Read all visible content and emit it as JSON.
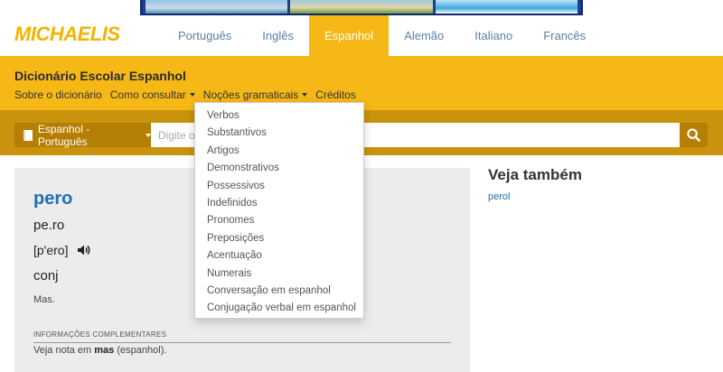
{
  "header": {
    "logo": "MICHAELIS",
    "languages": [
      "Português",
      "Inglês",
      "Espanhol",
      "Alemão",
      "Italiano",
      "Francês"
    ],
    "active_language": "Espanhol"
  },
  "dictionary": {
    "title": "Dicionário Escolar Espanhol",
    "subnav": [
      "Sobre o dicionário",
      "Como consultar",
      "Noções gramaticais",
      "Créditos"
    ]
  },
  "search": {
    "direction_label": "Espanhol - Português",
    "placeholder": "Digite o"
  },
  "dropdown": {
    "items": [
      "Verbos",
      "Substantivos",
      "Artigos",
      "Demonstrativos",
      "Possessivos",
      "Indefinidos",
      "Pronomes",
      "Preposições",
      "Acentuação",
      "Numerais",
      "Conversação em espanhol",
      "Conjugação verbal em espanhol"
    ]
  },
  "entry": {
    "headword": "pero",
    "syllables": "pe.ro",
    "phonetic": "[p'ero]",
    "pos": "conj",
    "translation": "Mas.",
    "info_label": "INFORMAÇÕES COMPLEMENTARES",
    "info_prefix": "Veja nota em",
    "info_word": "mas",
    "info_suffix": "(espanhol)."
  },
  "see_also": {
    "title": "Veja também",
    "link": "perol"
  },
  "colors": {
    "accent": "#f6b817",
    "dark_accent": "#c9930e",
    "link": "#1f6fb5"
  }
}
